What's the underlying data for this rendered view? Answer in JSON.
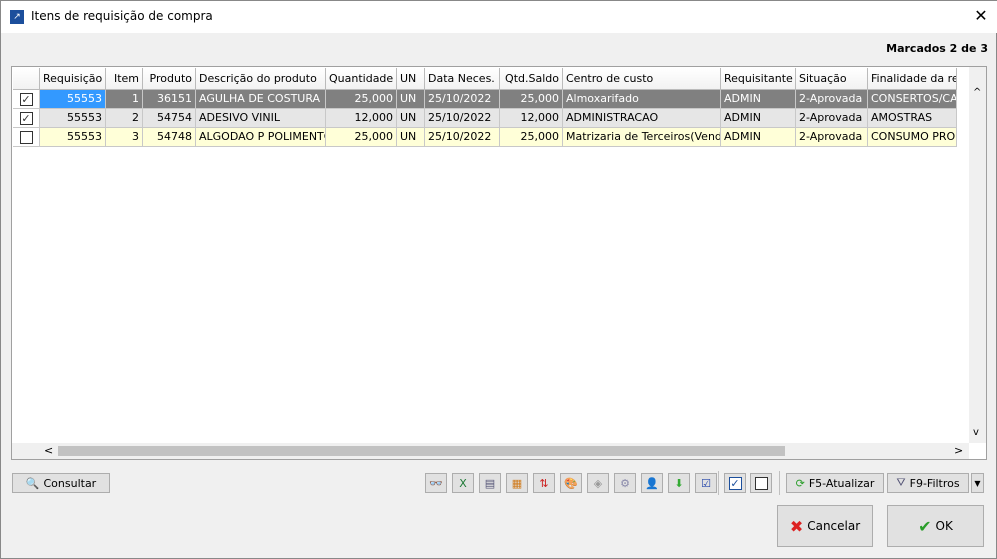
{
  "window": {
    "title": "Itens de requisição de compra",
    "close": "✕"
  },
  "marked": "Marcados 2 de 3",
  "columns": [
    "Requisição",
    "Item",
    "Produto",
    "Descrição do produto",
    "Quantidade",
    "UN",
    "Data Neces.",
    "Qtd.Saldo",
    "Centro de custo",
    "Requisitante",
    "Situação",
    "Finalidade da requis"
  ],
  "rows": [
    {
      "checked": true,
      "req": "55553",
      "item": "1",
      "prod": "36151",
      "desc": "AGULHA DE COSTURA",
      "qtd": "25,000",
      "un": "UN",
      "data": "25/10/2022",
      "saldo": "25,000",
      "centro": "Almoxarifado",
      "requisitante": "ADMIN",
      "situacao": "2-Aprovada",
      "finalidade": "CONSERTOS/CABED"
    },
    {
      "checked": true,
      "req": "55553",
      "item": "2",
      "prod": "54754",
      "desc": "ADESIVO VINIL",
      "qtd": "12,000",
      "un": "UN",
      "data": "25/10/2022",
      "saldo": "12,000",
      "centro": "ADMINISTRACAO",
      "requisitante": "ADMIN",
      "situacao": "2-Aprovada",
      "finalidade": "AMOSTRAS"
    },
    {
      "checked": false,
      "req": "55553",
      "item": "3",
      "prod": "54748",
      "desc": "ALGODAO P POLIMENTO",
      "qtd": "25,000",
      "un": "UN",
      "data": "25/10/2022",
      "saldo": "25,000",
      "centro": "Matrizaria de Terceiros(Venda)",
      "requisitante": "ADMIN",
      "situacao": "2-Aprovada",
      "finalidade": "CONSUMO PRODUC"
    }
  ],
  "toolbar": {
    "consultar": "Consultar",
    "atualizar": "F5-Atualizar",
    "filtros": "F9-Filtros"
  },
  "footer": {
    "cancelar": "Cancelar",
    "ok": "OK"
  },
  "scroll": {
    "up": "^",
    "down": "v",
    "left": "<",
    "right": ">"
  }
}
